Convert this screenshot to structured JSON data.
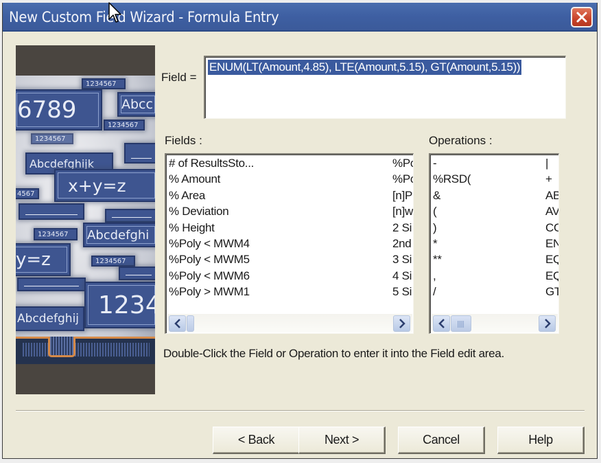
{
  "window": {
    "title": "New Custom Field Wizard - Formula Entry",
    "close_icon": "close-icon"
  },
  "side_image": {
    "tiles": [
      "6789",
      "Abcc",
      "1234567",
      "1234567",
      "1234567",
      "Abcdefghijk",
      "x+y=z",
      "4567",
      "1234567",
      "Abcdefghi",
      "y=z",
      "1234567",
      "1234",
      "Abcdefghij"
    ]
  },
  "field": {
    "label": "Field =",
    "value": "ENUM(LT(Amount,4.85), LTE(Amount,5.15), GT(Amount,5.15))"
  },
  "fields_list": {
    "label": "Fields :",
    "rows": [
      {
        "c1": "# of ResultsSto...",
        "c2": "%Pc"
      },
      {
        "c1": "% Amount",
        "c2": "%Pc"
      },
      {
        "c1": "% Area",
        "c2": "[n]P"
      },
      {
        "c1": "% Deviation",
        "c2": "[n]w"
      },
      {
        "c1": "% Height",
        "c2": "2 Si"
      },
      {
        "c1": "%Poly < MWM4",
        "c2": "2nd"
      },
      {
        "c1": "%Poly < MWM5",
        "c2": "3 Si"
      },
      {
        "c1": "%Poly < MWM6",
        "c2": "4 Si"
      },
      {
        "c1": "%Poly > MWM1",
        "c2": "5 Si"
      }
    ]
  },
  "operations_list": {
    "label": "Operations :",
    "rows": [
      {
        "c1": "-",
        "c2": "|"
      },
      {
        "c1": "%RSD(",
        "c2": "+"
      },
      {
        "c1": "&",
        "c2": "AB"
      },
      {
        "c1": "(",
        "c2": "AV"
      },
      {
        "c1": ")",
        "c2": "CO"
      },
      {
        "c1": "*",
        "c2": "EN"
      },
      {
        "c1": "**",
        "c2": "EQ"
      },
      {
        "c1": ",",
        "c2": "EQ"
      },
      {
        "c1": "/",
        "c2": "GT"
      }
    ]
  },
  "hint": "Double-Click the Field or Operation to enter it into the Field edit area.",
  "buttons": {
    "back": "< Back",
    "next": "Next >",
    "cancel": "Cancel",
    "help": "Help"
  },
  "colors": {
    "titlebar": "#3e5fa2",
    "dialog_bg": "#ece9d8",
    "selection": "#3a5a9e",
    "close_button": "#c8432a"
  }
}
